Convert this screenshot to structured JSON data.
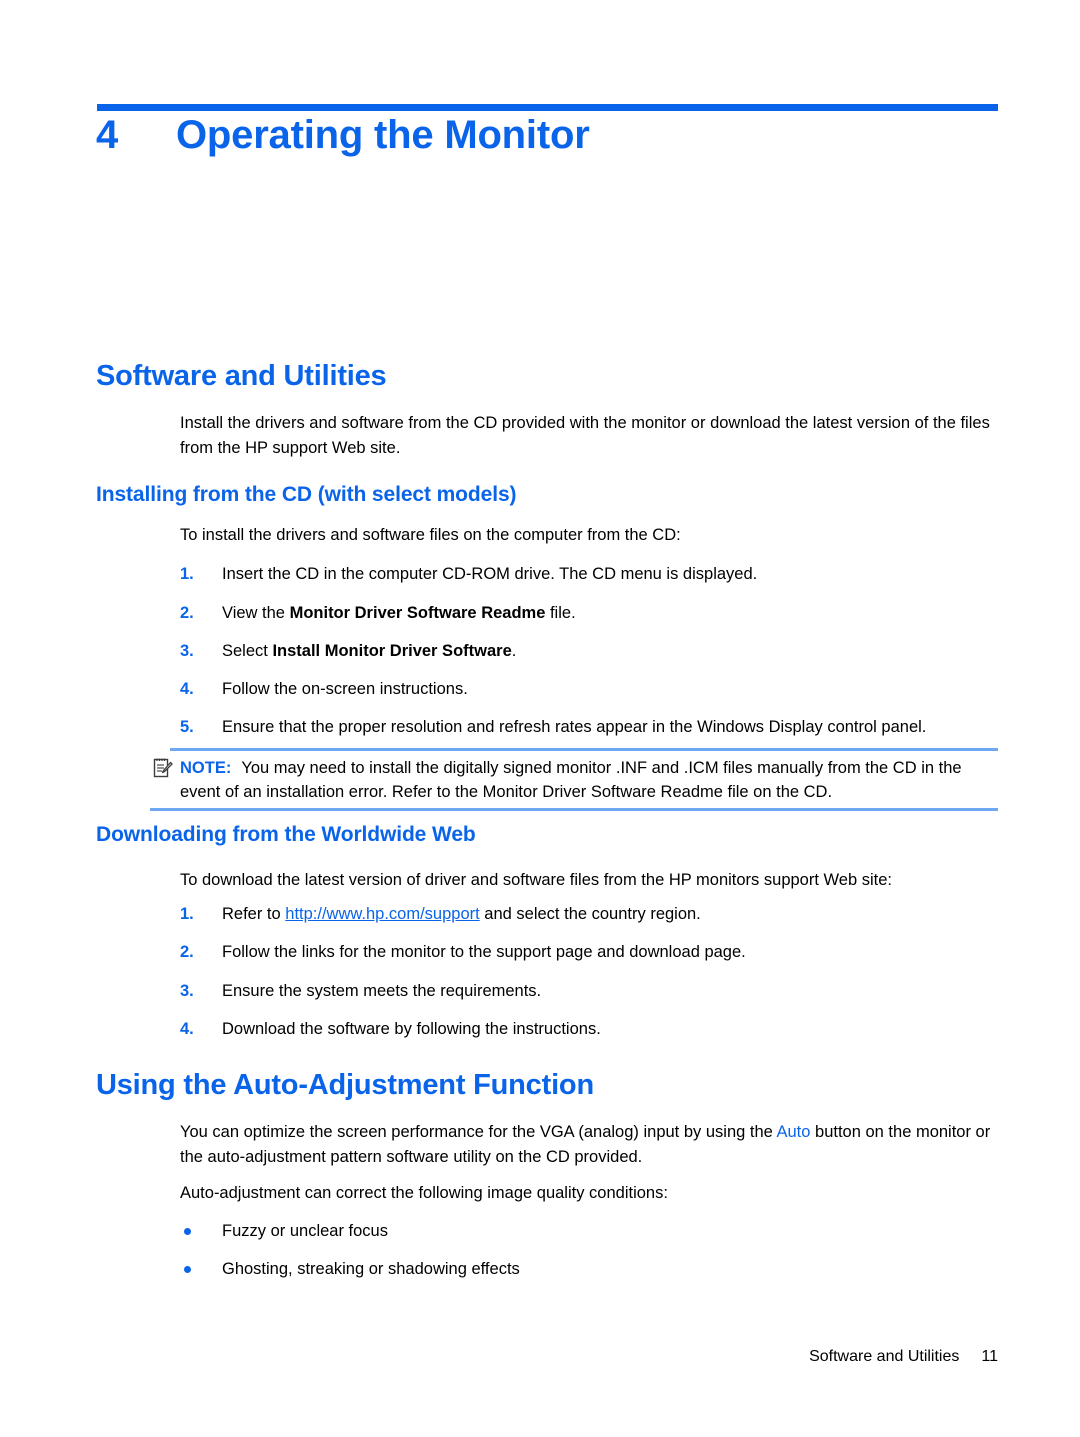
{
  "chapter": {
    "number": "4",
    "title": "Operating the Monitor"
  },
  "sections": {
    "software_utilities": {
      "heading": "Software and Utilities",
      "intro": "Install the drivers and software from the CD provided with the monitor or download the latest version of the files from the HP support Web site.",
      "installing_cd": {
        "heading": "Installing from the CD (with select models)",
        "intro": "To install the drivers and software files on the computer from the CD:",
        "steps": [
          {
            "num": "1.",
            "pre": "Insert the CD in the computer CD-ROM drive. The CD menu is displayed.",
            "bold": "",
            "post": ""
          },
          {
            "num": "2.",
            "pre": "View the ",
            "bold": "Monitor Driver Software Readme",
            "post": " file."
          },
          {
            "num": "3.",
            "pre": "Select ",
            "bold": "Install Monitor Driver Software",
            "post": "."
          },
          {
            "num": "4.",
            "pre": "Follow the on-screen instructions.",
            "bold": "",
            "post": ""
          },
          {
            "num": "5.",
            "pre": "Ensure that the proper resolution and refresh rates appear in the Windows Display control panel.",
            "bold": "",
            "post": ""
          }
        ]
      },
      "note": {
        "icon": "note-pencil-icon",
        "label": "NOTE:",
        "text": "You may need to install the digitally signed monitor .INF and .ICM files manually from the CD in the event of an installation error. Refer to the Monitor Driver Software Readme file on the CD."
      },
      "downloading_web": {
        "heading": "Downloading from the Worldwide Web",
        "intro": "To download the latest version of driver and software files from the HP monitors support Web site:",
        "steps": [
          {
            "num": "1.",
            "pre": "Refer to ",
            "link": "http://www.hp.com/support",
            "post": " and select the country region."
          },
          {
            "num": "2.",
            "pre": "Follow the links for the monitor to the support page and download page.",
            "link": "",
            "post": ""
          },
          {
            "num": "3.",
            "pre": "Ensure the system meets the requirements.",
            "link": "",
            "post": ""
          },
          {
            "num": "4.",
            "pre": "Download the software by following the instructions.",
            "link": "",
            "post": ""
          }
        ]
      }
    },
    "auto_adjustment": {
      "heading": "Using the Auto-Adjustment Function",
      "para1_pre": "You can optimize the screen performance for the VGA (analog) input by using the ",
      "para1_blue": "Auto",
      "para1_post": " button on the monitor or the auto-adjustment pattern software utility on the CD provided.",
      "para2": "Auto-adjustment can correct the following image quality conditions:",
      "bullets": [
        "Fuzzy or unclear focus",
        "Ghosting, streaking or shadowing effects"
      ]
    }
  },
  "footer": {
    "text": "Software and Utilities",
    "page": "11"
  },
  "colors": {
    "accent_blue": "#0a64ea",
    "rule_light_blue": "#6fa8f2",
    "body_text": "#000000"
  }
}
